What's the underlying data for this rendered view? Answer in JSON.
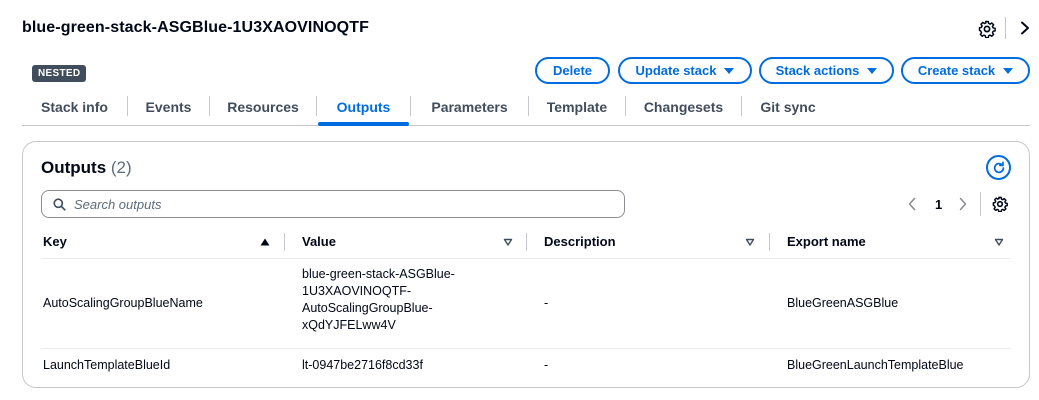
{
  "stack": {
    "title": "blue-green-stack-ASGBlue-1U3XAOVINOQTF",
    "badge": "NESTED"
  },
  "actions": {
    "delete": "Delete",
    "update": "Update stack",
    "stack_actions": "Stack actions",
    "create": "Create stack"
  },
  "tabs": [
    {
      "label": "Stack info"
    },
    {
      "label": "Events"
    },
    {
      "label": "Resources"
    },
    {
      "label": "Outputs",
      "active": true
    },
    {
      "label": "Parameters"
    },
    {
      "label": "Template"
    },
    {
      "label": "Changesets"
    },
    {
      "label": "Git sync"
    }
  ],
  "outputs": {
    "title": "Outputs",
    "count": "(2)",
    "search_placeholder": "Search outputs",
    "page": "1",
    "columns": [
      "Key",
      "Value",
      "Description",
      "Export name"
    ],
    "rows": [
      {
        "key": "AutoScalingGroupBlueName",
        "value_lines": [
          "blue-green-stack-ASGBlue-",
          "1U3XAOVINOQTF-",
          "AutoScalingGroupBlue-",
          "xQdYJFELww4V"
        ],
        "description": "-",
        "export": "BlueGreenASGBlue"
      },
      {
        "key": "LaunchTemplateBlueId",
        "value_lines": [
          "lt-0947be2716f8cd33f"
        ],
        "description": "-",
        "export": "BlueGreenLaunchTemplateBlue"
      }
    ]
  },
  "colors": {
    "accent": "#006ce0",
    "text": "#000716",
    "badge_bg": "#414d5c",
    "border": "#c6c6cd"
  },
  "icons": [
    "settings-gear-icon",
    "chevron-right-icon",
    "caret-down-icon",
    "refresh-icon",
    "search-icon",
    "chevron-left-icon",
    "sort-ascending-icon",
    "sort-descending-icon"
  ]
}
